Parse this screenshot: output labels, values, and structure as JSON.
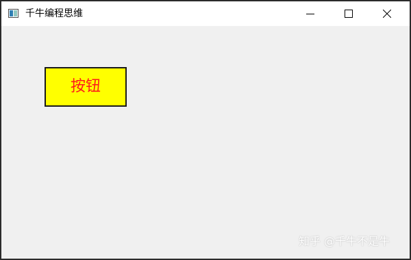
{
  "window": {
    "title": "千牛编程思维"
  },
  "titlebar_controls": {
    "minimize_icon": "minimize-icon",
    "maximize_icon": "maximize-icon",
    "close_icon": "close-icon"
  },
  "content": {
    "button_label": "按钮",
    "button_colors": {
      "background": "#ffff00",
      "text": "#ff1a1a"
    }
  },
  "watermark": {
    "text": "知乎 @千牛不是牛"
  }
}
